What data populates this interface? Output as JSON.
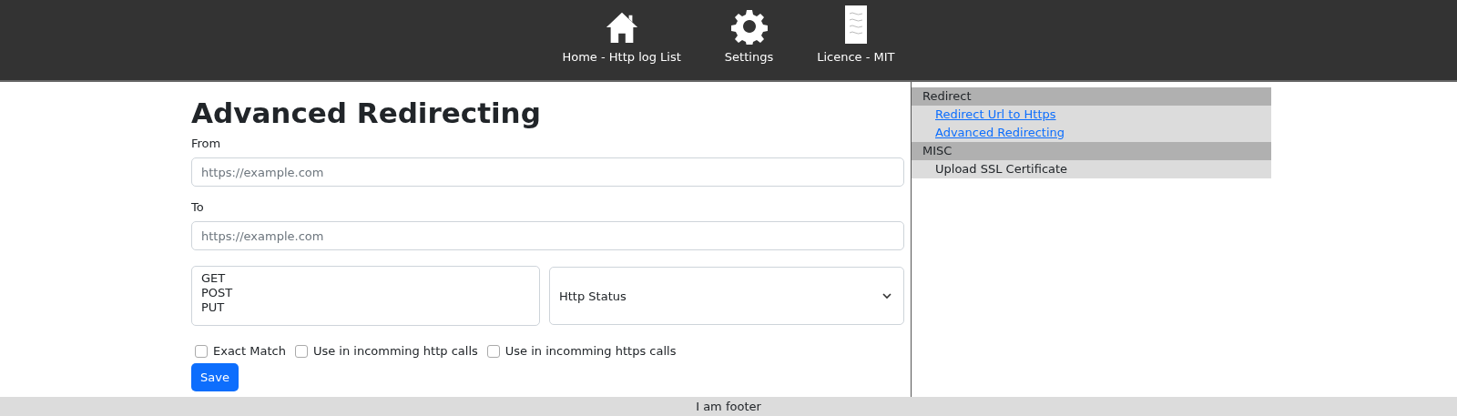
{
  "nav": [
    {
      "label": "Home - Http log List"
    },
    {
      "label": "Settings"
    },
    {
      "label": "Licence - MIT"
    }
  ],
  "page": {
    "title": "Advanced Redirecting",
    "from": {
      "label": "From",
      "placeholder": "https://example.com"
    },
    "to": {
      "label": "To",
      "placeholder": "https://example.com"
    },
    "methods": [
      "GET",
      "POST",
      "PUT"
    ],
    "status_select": {
      "value": "Http Status"
    },
    "checkboxes": [
      {
        "label": "Exact Match",
        "checked": false
      },
      {
        "label": "Use in incomming http calls",
        "checked": false
      },
      {
        "label": "Use in incomming https calls",
        "checked": false
      }
    ],
    "save_button": "Save"
  },
  "sidebar": [
    {
      "heading": "Redirect",
      "items": [
        {
          "label": "Redirect Url to Https",
          "kind": "link"
        },
        {
          "label": "Advanced Redirecting",
          "kind": "link"
        }
      ]
    },
    {
      "heading": "MISC",
      "items": [
        {
          "label": "Upload SSL Certificate",
          "kind": "text"
        }
      ]
    }
  ],
  "footer": "I am footer"
}
